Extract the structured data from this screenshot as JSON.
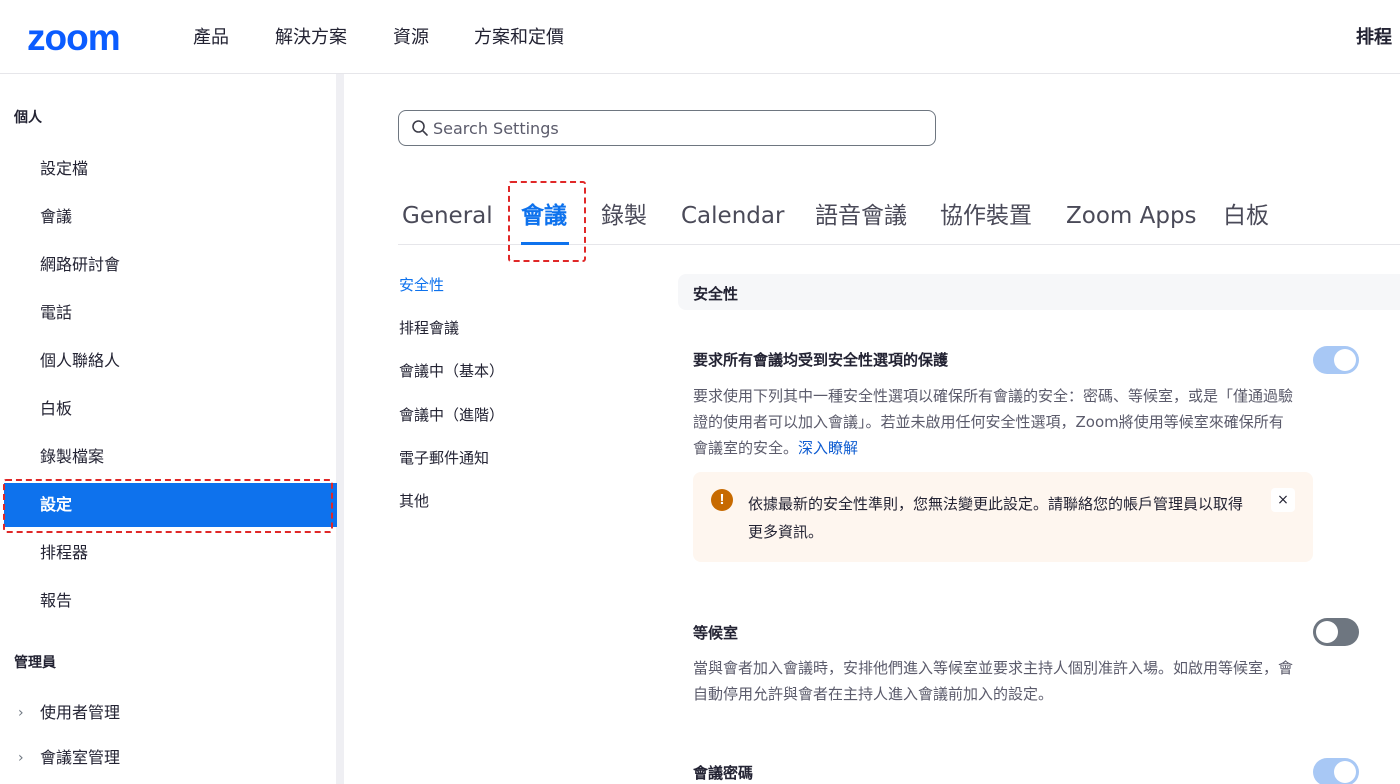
{
  "brand": {
    "logo": "zoom",
    "accent": "#0b5cff",
    "active_blue": "#0e72ed"
  },
  "topnav": {
    "items": [
      "產品",
      "解決方案",
      "資源",
      "方案和定價"
    ],
    "right": "排程"
  },
  "sidebar": {
    "personal_heading": "個人",
    "items": [
      "設定檔",
      "會議",
      "網路研討會",
      "電話",
      "個人聯絡人",
      "白板",
      "錄製檔案",
      "設定",
      "排程器",
      "報告"
    ],
    "active_index": 7,
    "admin_heading": "管理員",
    "admin_items": [
      "使用者管理",
      "會議室管理"
    ]
  },
  "search": {
    "placeholder": "Search Settings",
    "value": ""
  },
  "tabs": {
    "items": [
      "General",
      "會議",
      "錄製",
      "Calendar",
      "語音會議",
      "協作裝置",
      "Zoom Apps",
      "白板"
    ],
    "active_index": 1
  },
  "subnav": {
    "items": [
      "安全性",
      "排程會議",
      "會議中（基本）",
      "會議中（進階）",
      "電子郵件通知",
      "其他"
    ],
    "active_index": 0
  },
  "section": {
    "title": "安全性"
  },
  "settings": [
    {
      "title": "要求所有會議均受到安全性選項的保護",
      "desc": "要求使用下列其中一種安全性選項以確保所有會議的安全：密碼、等候室，或是「僅通過驗證的使用者可以加入會議」。若並未啟用任何安全性選項，Zoom將使用等候室來確保所有會議室的安全。",
      "learn_more": "深入瞭解",
      "enabled": true,
      "locked": true
    },
    {
      "title": "等候室",
      "desc": "當與會者加入會議時，安排他們進入等候室並要求主持人個別准許入場。如啟用等候室，會自動停用允許與會者在主持人進入會議前加入的設定。",
      "enabled": false
    },
    {
      "title": "會議密碼",
      "enabled": true
    }
  ],
  "alert": {
    "icon": "exclamation-icon",
    "text": "依據最新的安全性準則，您無法變更此設定。請聯絡您的帳戶管理員以取得更多資訊。",
    "close": "×"
  }
}
